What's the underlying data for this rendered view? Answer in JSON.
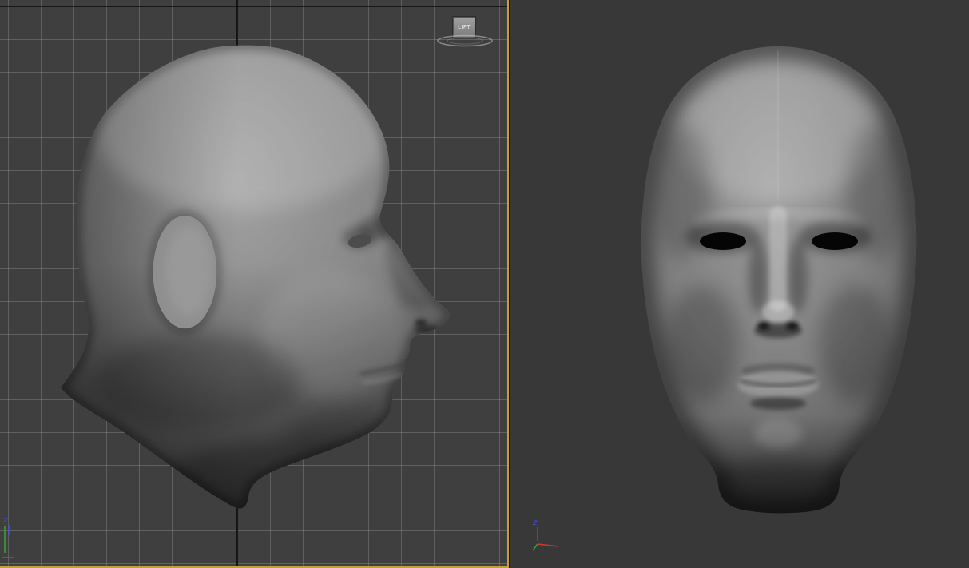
{
  "left_viewport": {
    "lift_label": "LIFT"
  },
  "axis_gizmo": {
    "z_label": "z",
    "z_color": "#4a4ae6",
    "x_color": "#cf3a2a",
    "y_color": "#3aa43a"
  },
  "colors": {
    "active_viewport_border": "#c2a037",
    "left_viewport_background": "#3f3f3f",
    "grid_line": "#616161",
    "grid_origin_line": "#141414",
    "right_viewport_background": "#383838",
    "model_base_gray": "#7d7d7d",
    "eye_hole_black": "#000000",
    "lift_box_gray": "#8f8f8f"
  },
  "scene": {
    "left_model": "head-profile-mesh",
    "right_model": "head-front-mesh"
  }
}
